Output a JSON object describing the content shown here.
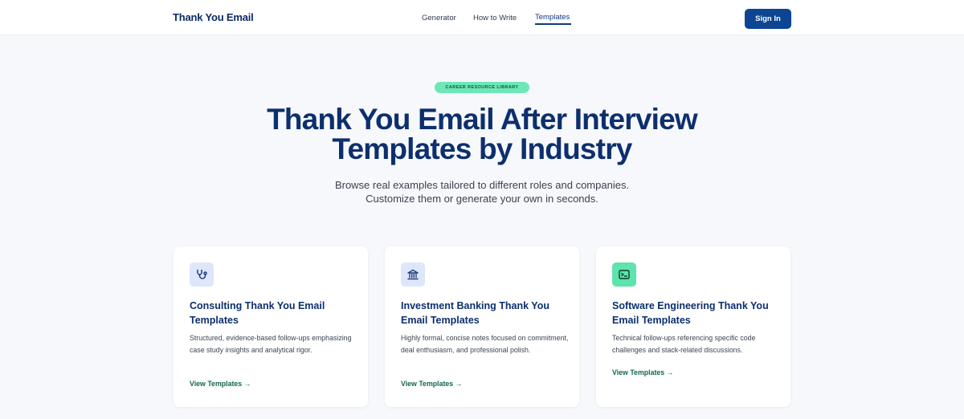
{
  "nav": {
    "brand": "Thank You Email",
    "links": [
      "Generator",
      "How to Write",
      "Templates"
    ],
    "active": "Templates",
    "signin_label": "Sign In"
  },
  "hero": {
    "badge": "CAREER RESOURCE LIBRARY",
    "title_line1": "Thank You Email After Interview",
    "title_line2": "Templates by Industry",
    "subtitle_line1": "Browse real examples tailored to different roles and companies.",
    "subtitle_line2": "Customize them or generate your own in seconds."
  },
  "cards": [
    {
      "icon": "stethoscope-icon",
      "title": "Consulting Thank You Email Templates",
      "description": "Structured, evidence-based follow-ups emphasizing case study insights and analytical rigor.",
      "link": "View Templates →"
    },
    {
      "icon": "bank-icon",
      "title": "Investment Banking Thank You Email Templates",
      "description": "Highly formal, concise notes focused on commitment, deal enthusiasm, and professional polish.",
      "link": "View Templates →"
    },
    {
      "icon": "terminal-icon",
      "title": "Software Engineering Thank You Email Templates",
      "description": "Technical follow-ups referencing specific code challenges and stack-related discussions.",
      "link": "View Templates →"
    }
  ],
  "colors": {
    "primary": "#0b4593",
    "heading": "#0d2f6e",
    "accent_green": "#6ee7b7",
    "link_green": "#0f6a44",
    "background": "#f6f8fb"
  }
}
